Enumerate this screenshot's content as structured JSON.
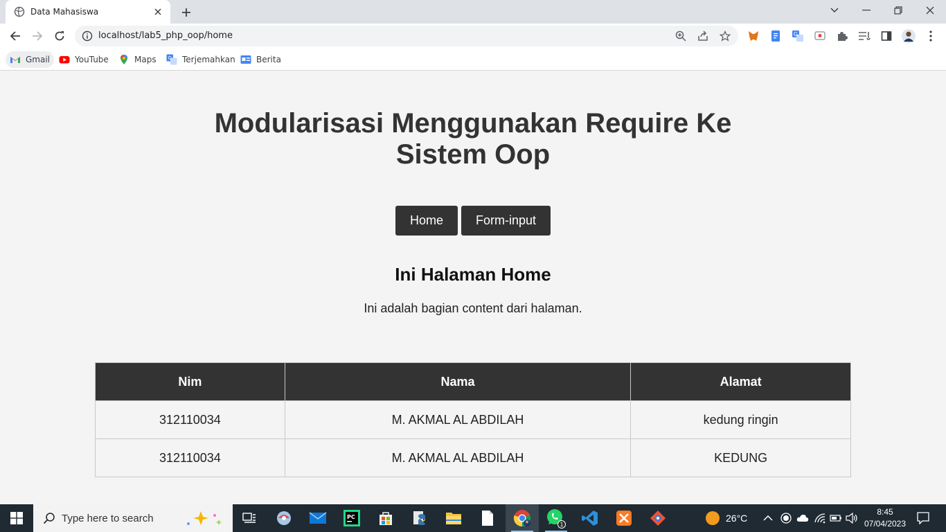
{
  "browser": {
    "tab_title": "Data Mahasiswa",
    "url": "localhost/lab5_php_oop/home",
    "bookmarks": [
      {
        "label": "Gmail",
        "icon": "gmail-icon"
      },
      {
        "label": "YouTube",
        "icon": "youtube-icon"
      },
      {
        "label": "Maps",
        "icon": "maps-icon"
      },
      {
        "label": "Terjemahkan",
        "icon": "translate-icon"
      },
      {
        "label": "Berita",
        "icon": "news-icon"
      }
    ]
  },
  "page": {
    "title": "Modularisasi Menggunakan Require Ke Sistem Oop",
    "nav": [
      {
        "label": "Home"
      },
      {
        "label": "Form-input"
      }
    ],
    "content_heading": "Ini Halaman Home",
    "content_text": "Ini adalah bagian content dari halaman.",
    "table": {
      "headers": [
        "Nim",
        "Nama",
        "Alamat"
      ],
      "rows": [
        [
          "312110034",
          "M. AKMAL AL ABDILAH",
          "kedung ringin"
        ],
        [
          "312110034",
          "M. AKMAL AL ABDILAH",
          "KEDUNG"
        ]
      ]
    }
  },
  "taskbar": {
    "search_placeholder": "Type here to search",
    "weather": "26°C",
    "time": "8:45",
    "date": "07/04/2023",
    "whatsapp_badge": "1"
  },
  "colors": {
    "page_bg": "#f4f4f4",
    "header_dark": "#333333",
    "taskbar": "#1f2a33"
  }
}
